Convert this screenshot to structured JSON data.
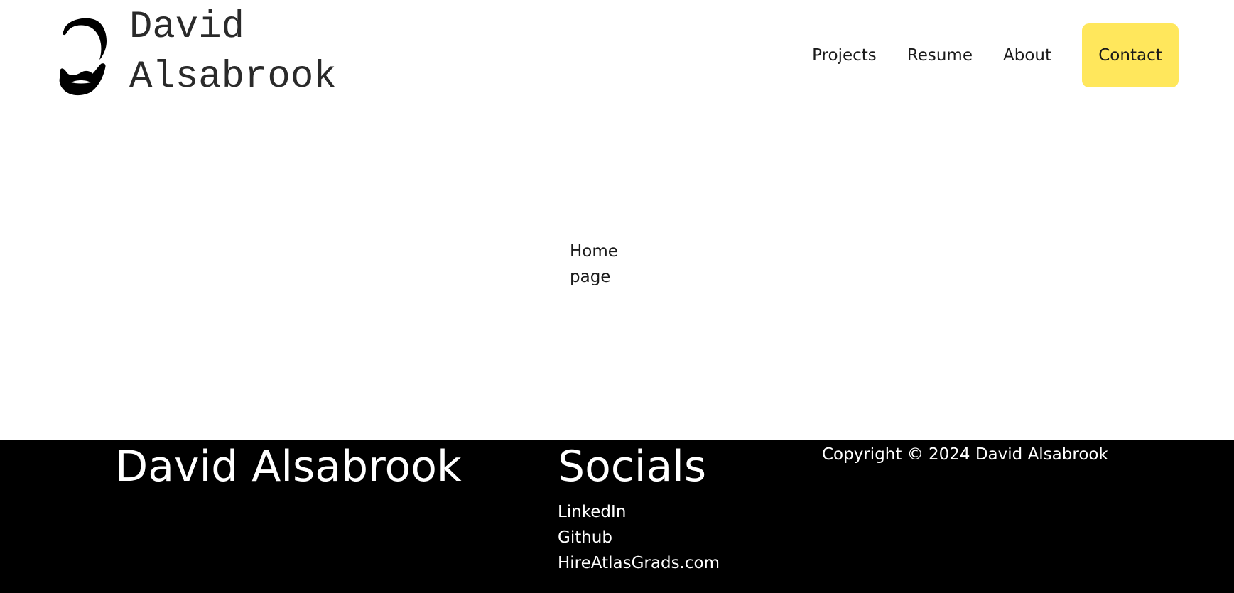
{
  "header": {
    "logo_text": "David\nAlsabrook",
    "nav": {
      "projects": "Projects",
      "resume": "Resume",
      "about": "About",
      "contact": "Contact"
    },
    "contact_color": "#ffe75c"
  },
  "main": {
    "home_text": "Home page"
  },
  "footer": {
    "name": "David Alsabrook",
    "socials_heading": "Socials",
    "socials": [
      "LinkedIn",
      "Github",
      "HireAtlasGrads.com"
    ],
    "copyright": "Copyright © 2024 David Alsabrook"
  }
}
